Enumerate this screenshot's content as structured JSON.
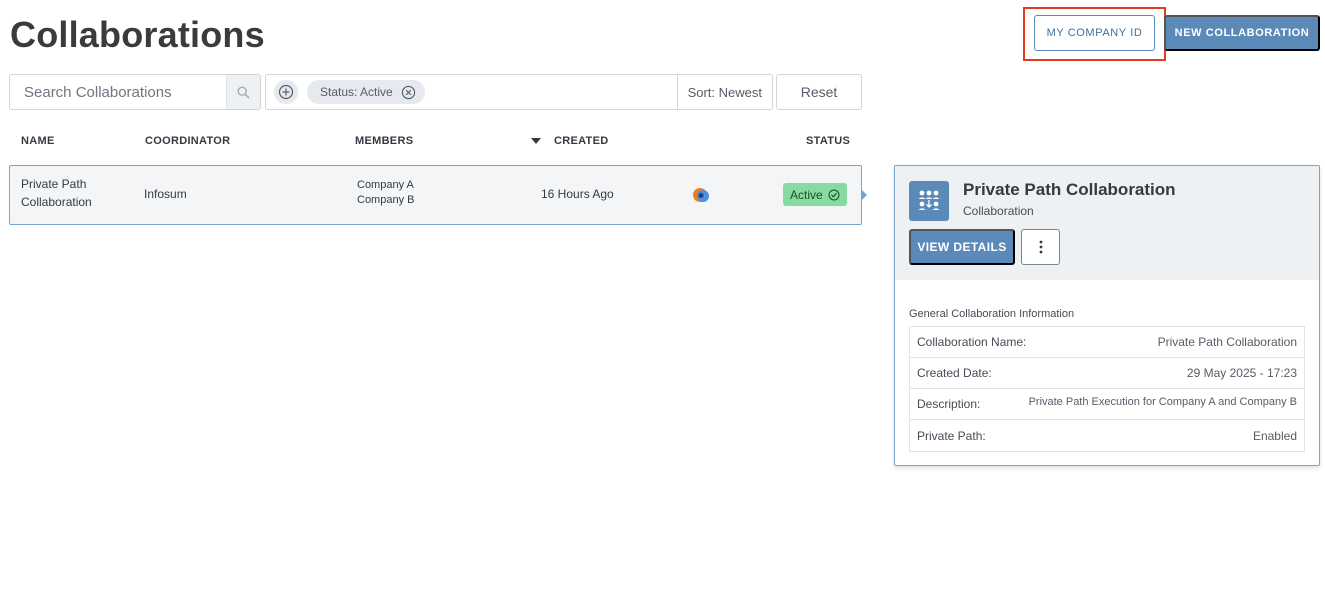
{
  "page": {
    "title": "Collaborations"
  },
  "header": {
    "company_id_label": "MY COMPANY ID",
    "new_collab_label": "NEW COLLABORATION"
  },
  "search": {
    "placeholder": "Search Collaborations"
  },
  "filters": {
    "chip_label": "Status: Active",
    "sort_label": "Sort: Newest",
    "reset_label": "Reset"
  },
  "table": {
    "columns": [
      "NAME",
      "COORDINATOR",
      "MEMBERS",
      "CREATED",
      "STATUS"
    ],
    "sorted_column": "CREATED",
    "rows": [
      {
        "name_line1": "Private Path",
        "name_line2": "Collaboration",
        "coordinator": "Infosum",
        "member1": "Company A",
        "member2": "Company B",
        "created": "16 Hours Ago",
        "status": "Active"
      }
    ]
  },
  "detail": {
    "title": "Private Path Collaboration",
    "subtitle": "Collaboration",
    "view_details_label": "VIEW DETAILS",
    "section_title": "General Collaboration Information",
    "fields": [
      {
        "label": "Collaboration Name:",
        "value": "Private Path Collaboration"
      },
      {
        "label": "Created Date:",
        "value": "29 May 2025 - 17:23"
      },
      {
        "label": "Description:",
        "value": "Private Path Execution for Company A and Company B"
      },
      {
        "label": "Private Path:",
        "value": "Enabled"
      }
    ]
  },
  "icons": {
    "search": "search-icon",
    "add_filter": "plus-circle-icon",
    "remove_chip": "close-circle-icon",
    "sort_caret": "caret-down-icon",
    "status_check": "check-circle-icon",
    "coordinator_logo": "infosum-logo-icon",
    "collaboration": "group-icon",
    "more": "more-vertical-icon"
  },
  "colors": {
    "primary": "#5b89b8",
    "highlight": "#e43a20",
    "active_badge": "#86dca0",
    "selected_row_border": "#7aa4cc"
  }
}
